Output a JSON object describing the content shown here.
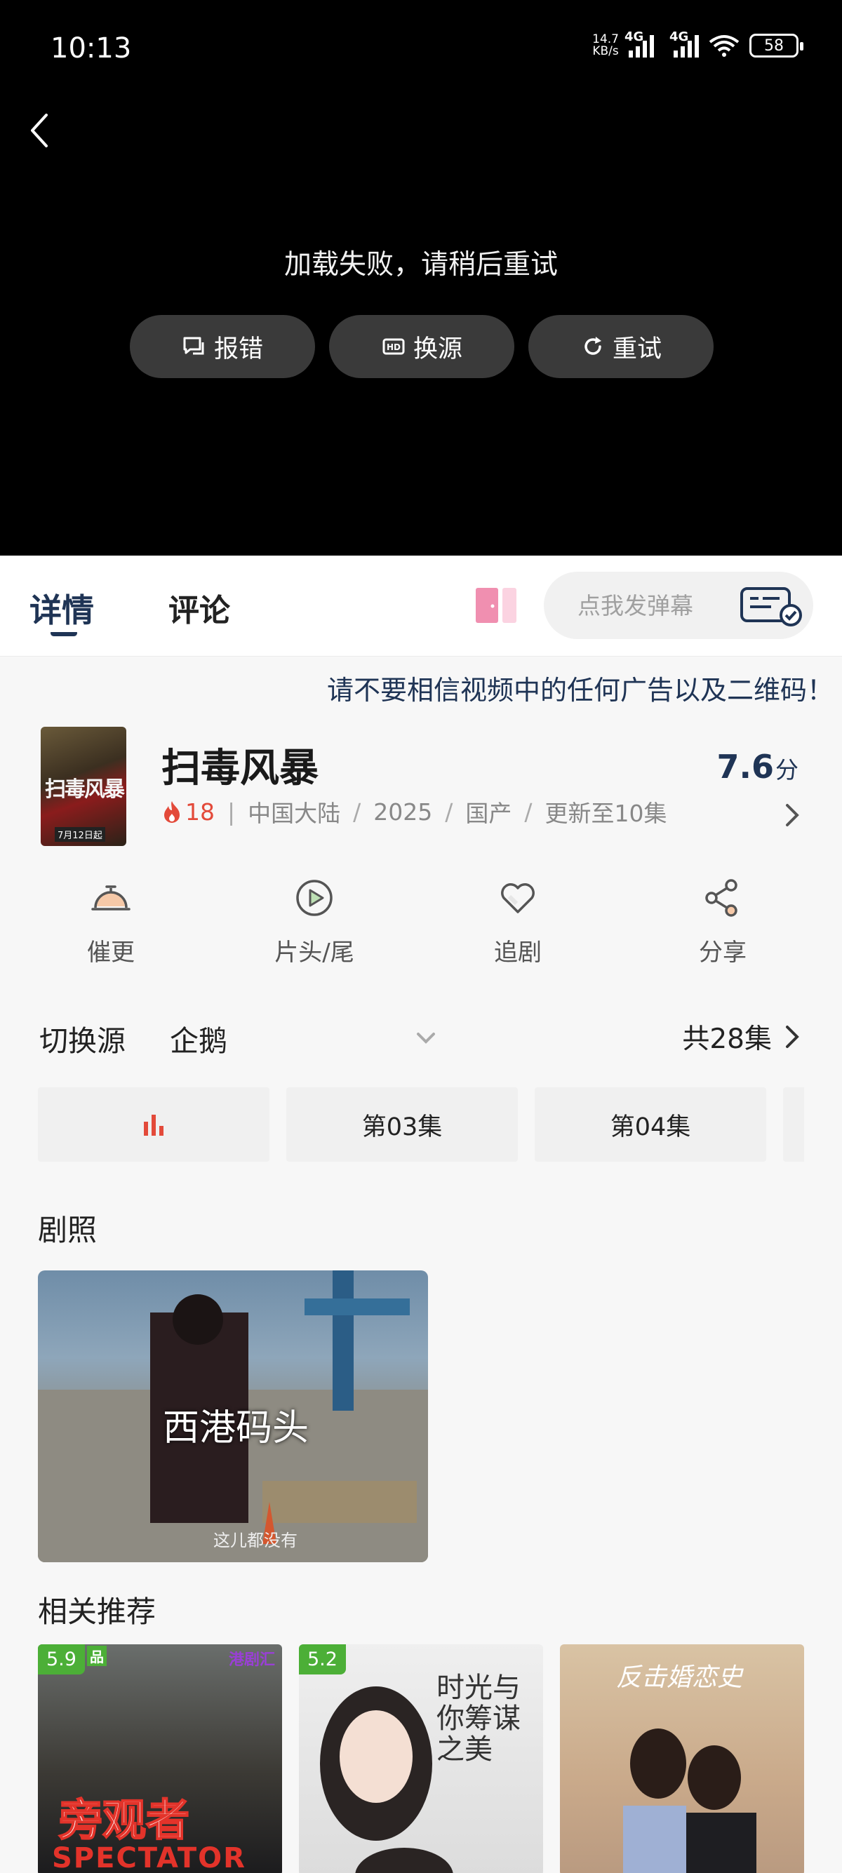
{
  "status_bar": {
    "time": "10:13",
    "net_speed_value": "14.7",
    "net_speed_unit": "KB/s",
    "sim1": "4G",
    "sim2": "4G",
    "wifi_band": "6",
    "battery": "58"
  },
  "player": {
    "error_message": "加载失败，请稍后重试",
    "buttons": [
      {
        "label": "报错",
        "icon": "report-icon"
      },
      {
        "label": "换源",
        "icon": "hd-source-icon"
      },
      {
        "label": "重试",
        "icon": "refresh-icon"
      }
    ]
  },
  "tabs": {
    "detail": "详情",
    "comments": "评论"
  },
  "danmu": {
    "placeholder": "点我发弹幕"
  },
  "notice": "请不要相信视频中的任何广告以及二维码！",
  "show": {
    "poster_text": "扫毒风暴",
    "poster_date": "7月12日起",
    "title": "扫毒风暴",
    "heat": "18",
    "region": "中国大陆",
    "year": "2025",
    "category": "国产",
    "status": "更新至10集",
    "score": "7.6",
    "score_unit": "分"
  },
  "actions": [
    {
      "label": "催更",
      "icon": "bell-icon"
    },
    {
      "label": "片头/尾",
      "icon": "play-circle-icon"
    },
    {
      "label": "追剧",
      "icon": "heart-icon"
    },
    {
      "label": "分享",
      "icon": "share-icon"
    }
  ],
  "source": {
    "label": "切换源",
    "current": "企鹅",
    "total": "共28集"
  },
  "episodes": [
    "",
    "第03集",
    "第04集",
    ""
  ],
  "stills": {
    "title": "剧照",
    "caption": "西港码头",
    "subtitle": "这儿都没有"
  },
  "recommend": {
    "title": "相关推荐",
    "items": [
      {
        "score": "5.9",
        "tag": "港剧汇",
        "text": "旁观者",
        "text2": "SPECTATOR",
        "corner": "品"
      },
      {
        "score": "5.2",
        "text": "时光与你筹谋之美"
      },
      {
        "score": "",
        "text": "反击婚恋史"
      }
    ]
  },
  "colors": {
    "accent": "#1f3455",
    "heat": "#e34a3a",
    "score_badge": "#4caf37",
    "player_bg": "#000000"
  }
}
